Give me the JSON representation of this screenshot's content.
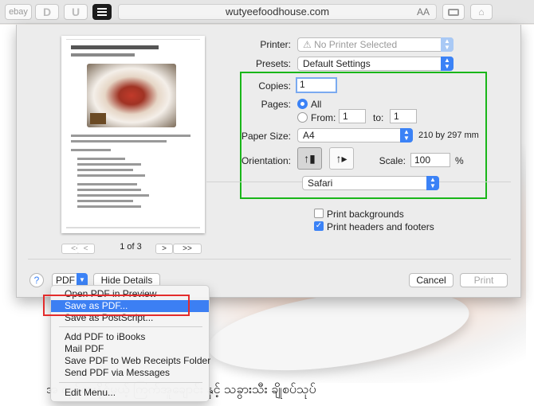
{
  "browser": {
    "ebay_label": "ebay",
    "d_label": "D",
    "u_label": "U",
    "url": "wutyeefoodhouse.com",
    "text_size_label": "AA"
  },
  "page": {
    "bottom_text": "အ                                    လုပ်စားနိုင်မယ့် ကြက်အူချောင်း နှင့် သခွားသီး ချိုစပ်သုပ်"
  },
  "preview": {
    "page_count": "1 of 3",
    "nav_first": "<<",
    "nav_prev": "<",
    "nav_next": ">",
    "nav_last": ">>"
  },
  "print": {
    "printer_label": "Printer:",
    "printer_value": "⚠ No Printer Selected",
    "presets_label": "Presets:",
    "presets_value": "Default Settings",
    "copies_label": "Copies:",
    "copies_value": "1",
    "pages_label": "Pages:",
    "pages_all": "All",
    "pages_from": "From:",
    "from_value": "1",
    "to_label": "to:",
    "to_value": "1",
    "paper_size_label": "Paper Size:",
    "paper_size_value": "A4",
    "paper_size_dims": "210 by 297 mm",
    "orientation_label": "Orientation:",
    "scale_label": "Scale:",
    "scale_value": "100",
    "scale_unit": "%",
    "app_section": "Safari",
    "print_backgrounds": "Print backgrounds",
    "print_headers_footers": "Print headers and footers",
    "print_backgrounds_checked": false,
    "print_headers_footers_checked": true
  },
  "bottom_bar": {
    "help": "?",
    "pdf": "PDF",
    "hide_details": "Hide Details",
    "cancel": "Cancel",
    "print": "Print"
  },
  "pdf_menu": {
    "items": [
      "Open PDF in Preview",
      "Save as PDF...",
      "Save as PostScript...",
      "Add PDF to iBooks",
      "Mail PDF",
      "Save PDF to Web Receipts Folder",
      "Send PDF via Messages",
      "Edit Menu..."
    ],
    "highlighted": "Save as PDF..."
  },
  "colors": {
    "accent": "#3b82f6",
    "highlight_box": "#19b619",
    "annotation_box": "#e32c2c"
  }
}
